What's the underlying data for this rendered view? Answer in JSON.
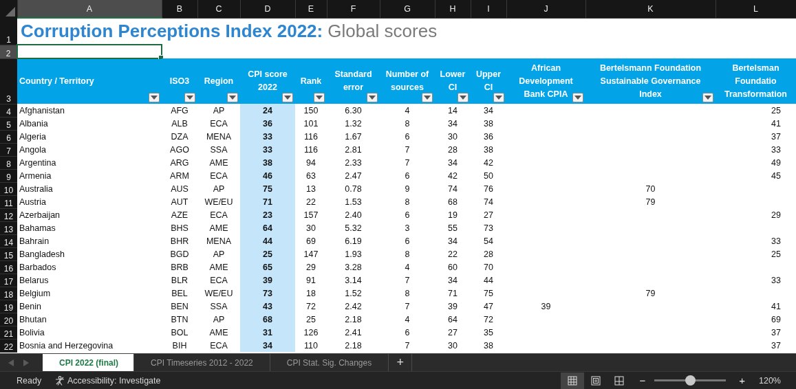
{
  "column_headers": [
    {
      "label": "A",
      "selected": true
    },
    {
      "label": "B",
      "selected": false
    },
    {
      "label": "C",
      "selected": false
    },
    {
      "label": "D",
      "selected": false
    },
    {
      "label": "E",
      "selected": false
    },
    {
      "label": "F",
      "selected": false
    },
    {
      "label": "G",
      "selected": false
    },
    {
      "label": "H",
      "selected": false
    },
    {
      "label": "I",
      "selected": false
    },
    {
      "label": "J",
      "selected": false
    },
    {
      "label": "K",
      "selected": false
    },
    {
      "label": "L",
      "selected": false
    }
  ],
  "row_numbers": [
    {
      "label": "1",
      "selected": false
    },
    {
      "label": "2",
      "selected": true
    },
    {
      "label": "3",
      "selected": false
    },
    {
      "label": "4",
      "selected": false
    },
    {
      "label": "5",
      "selected": false
    },
    {
      "label": "6",
      "selected": false
    },
    {
      "label": "7",
      "selected": false
    },
    {
      "label": "8",
      "selected": false
    },
    {
      "label": "9",
      "selected": false
    },
    {
      "label": "10",
      "selected": false
    },
    {
      "label": "11",
      "selected": false
    },
    {
      "label": "12",
      "selected": false
    },
    {
      "label": "13",
      "selected": false
    },
    {
      "label": "14",
      "selected": false
    },
    {
      "label": "15",
      "selected": false
    },
    {
      "label": "16",
      "selected": false
    },
    {
      "label": "17",
      "selected": false
    },
    {
      "label": "18",
      "selected": false
    },
    {
      "label": "19",
      "selected": false
    },
    {
      "label": "20",
      "selected": false
    },
    {
      "label": "21",
      "selected": false
    },
    {
      "label": "22",
      "selected": false
    }
  ],
  "title": "Corruption Perceptions Index 2022:",
  "subtitle": "Global scores",
  "table": {
    "columns": [
      {
        "header": "Country / Territory",
        "filter": true,
        "highlighted": false
      },
      {
        "header": "ISO3",
        "filter": true,
        "highlighted": false
      },
      {
        "header": "Region",
        "filter": true,
        "highlighted": false
      },
      {
        "header": "CPI score\n2022",
        "filter": true,
        "highlighted": true
      },
      {
        "header": "Rank",
        "filter": true,
        "highlighted": false
      },
      {
        "header": "Standard\nerror",
        "filter": true,
        "highlighted": false
      },
      {
        "header": "Number of\nsources",
        "filter": true,
        "highlighted": false
      },
      {
        "header": "Lower\nCI",
        "filter": true,
        "highlighted": false
      },
      {
        "header": "Upper\nCI",
        "filter": true,
        "highlighted": false
      },
      {
        "header": "African\nDevelopment\nBank CPIA",
        "filter": true,
        "highlighted": false
      },
      {
        "header": "Bertelsmann Foundation\nSustainable Governance\nIndex",
        "filter": true,
        "highlighted": false
      },
      {
        "header": "Bertelsman\nFoundatio\nTransformation",
        "filter": false,
        "highlighted": false
      }
    ],
    "rows": [
      [
        "Afghanistan",
        "AFG",
        "AP",
        "24",
        "150",
        "6.30",
        "4",
        "14",
        "34",
        null,
        null,
        "25"
      ],
      [
        "Albania",
        "ALB",
        "ECA",
        "36",
        "101",
        "1.32",
        "8",
        "34",
        "38",
        null,
        null,
        "41"
      ],
      [
        "Algeria",
        "DZA",
        "MENA",
        "33",
        "116",
        "1.67",
        "6",
        "30",
        "36",
        null,
        null,
        "37"
      ],
      [
        "Angola",
        "AGO",
        "SSA",
        "33",
        "116",
        "2.81",
        "7",
        "28",
        "38",
        null,
        null,
        "33"
      ],
      [
        "Argentina",
        "ARG",
        "AME",
        "38",
        "94",
        "2.33",
        "7",
        "34",
        "42",
        null,
        null,
        "49"
      ],
      [
        "Armenia",
        "ARM",
        "ECA",
        "46",
        "63",
        "2.47",
        "6",
        "42",
        "50",
        null,
        null,
        "45"
      ],
      [
        "Australia",
        "AUS",
        "AP",
        "75",
        "13",
        "0.78",
        "9",
        "74",
        "76",
        null,
        "70",
        null
      ],
      [
        "Austria",
        "AUT",
        "WE/EU",
        "71",
        "22",
        "1.53",
        "8",
        "68",
        "74",
        null,
        "79",
        null
      ],
      [
        "Azerbaijan",
        "AZE",
        "ECA",
        "23",
        "157",
        "2.40",
        "6",
        "19",
        "27",
        null,
        null,
        "29"
      ],
      [
        "Bahamas",
        "BHS",
        "AME",
        "64",
        "30",
        "5.32",
        "3",
        "55",
        "73",
        null,
        null,
        null
      ],
      [
        "Bahrain",
        "BHR",
        "MENA",
        "44",
        "69",
        "6.19",
        "6",
        "34",
        "54",
        null,
        null,
        "33"
      ],
      [
        "Bangladesh",
        "BGD",
        "AP",
        "25",
        "147",
        "1.93",
        "8",
        "22",
        "28",
        null,
        null,
        "25"
      ],
      [
        "Barbados",
        "BRB",
        "AME",
        "65",
        "29",
        "3.28",
        "4",
        "60",
        "70",
        null,
        null,
        null
      ],
      [
        "Belarus",
        "BLR",
        "ECA",
        "39",
        "91",
        "3.14",
        "7",
        "34",
        "44",
        null,
        null,
        "33"
      ],
      [
        "Belgium",
        "BEL",
        "WE/EU",
        "73",
        "18",
        "1.52",
        "8",
        "71",
        "75",
        null,
        "79",
        null
      ],
      [
        "Benin",
        "BEN",
        "SSA",
        "43",
        "72",
        "2.42",
        "7",
        "39",
        "47",
        "39",
        null,
        "41"
      ],
      [
        "Bhutan",
        "BTN",
        "AP",
        "68",
        "25",
        "2.18",
        "4",
        "64",
        "72",
        null,
        null,
        "69"
      ],
      [
        "Bolivia",
        "BOL",
        "AME",
        "31",
        "126",
        "2.41",
        "6",
        "27",
        "35",
        null,
        null,
        "37"
      ],
      [
        "Bosnia and Herzegovina",
        "BIH",
        "ECA",
        "34",
        "110",
        "2.18",
        "7",
        "30",
        "38",
        null,
        null,
        "37"
      ]
    ]
  },
  "tabs": [
    {
      "label": "CPI 2022 (final)",
      "selected": true
    },
    {
      "label": "CPI Timeseries 2012 - 2022",
      "selected": false
    },
    {
      "label": "CPI Stat. Sig. Changes",
      "selected": false
    }
  ],
  "add_sheet": "+",
  "status_bar": {
    "state": "Ready",
    "accessibility": "Accessibility: Investigate",
    "views": [
      {
        "kind": "normal",
        "selected": true
      },
      {
        "kind": "page-layout",
        "selected": false
      },
      {
        "kind": "page-break",
        "selected": false
      }
    ],
    "zoom_out": "−",
    "zoom_in": "+",
    "zoom": {
      "level": 0.5,
      "value": "120%"
    }
  }
}
